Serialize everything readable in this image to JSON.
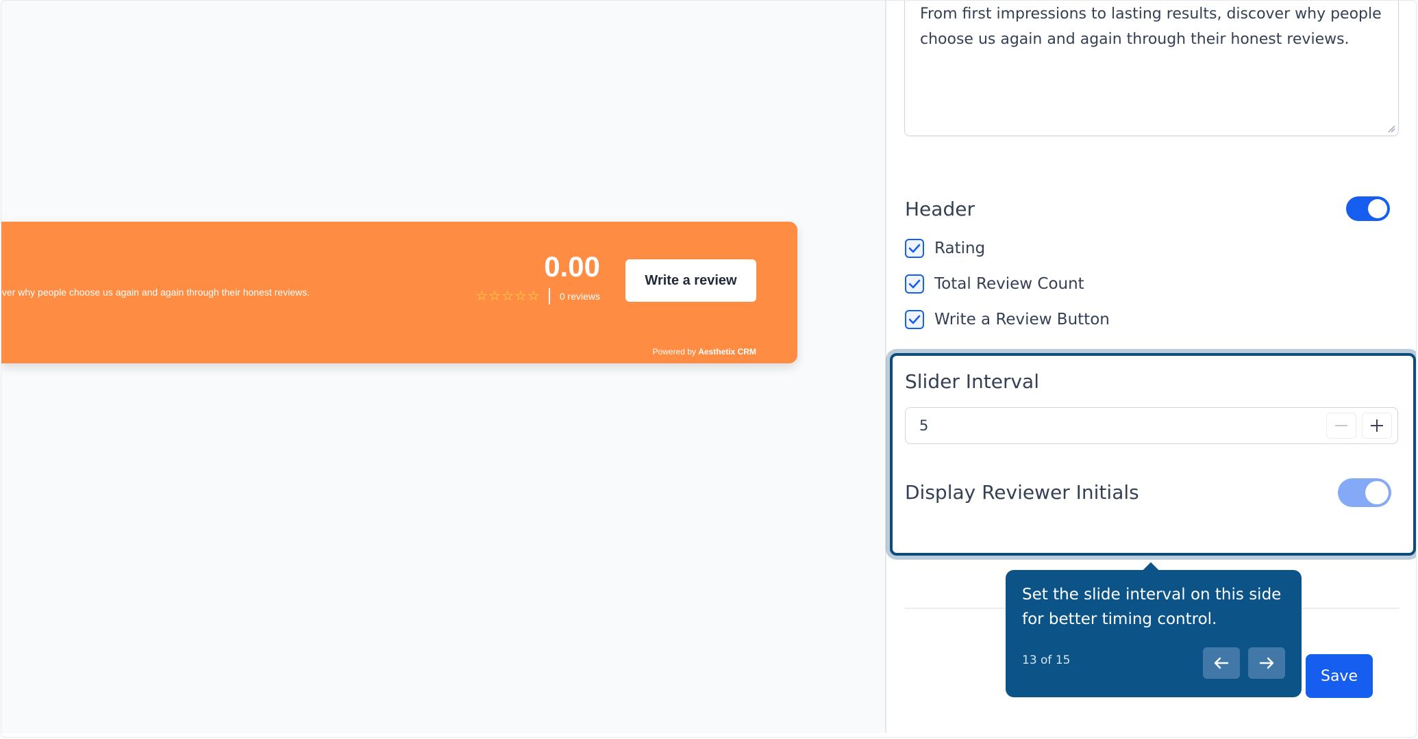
{
  "preview": {
    "description": "From first impressions to lasting results, discover why people choose us again and again through their honest reviews.",
    "rating": "0.00",
    "stars": "☆☆☆☆☆",
    "reviews_count": "0 reviews",
    "write_review_label": "Write a review",
    "powered_by": "Powered by",
    "powered_brand": "Aesthetix CRM"
  },
  "panel": {
    "description_text": "From first impressions to lasting results, discover why people choose us again and again through their honest reviews.",
    "header_label": "Header",
    "header_enabled": true,
    "checkboxes": [
      {
        "label": "Rating",
        "checked": true
      },
      {
        "label": "Total Review Count",
        "checked": true
      },
      {
        "label": "Write a Review Button",
        "checked": true
      }
    ],
    "slider_interval_label": "Slider Interval",
    "slider_interval_value": "5",
    "display_initials_label": "Display Reviewer Initials",
    "display_initials_enabled": true,
    "save_label": "Save"
  },
  "tooltip": {
    "text": "Set the slide interval on this side for better timing control.",
    "step": "13 of 15"
  },
  "colors": {
    "banner": "#fe8c42",
    "primary": "#155eef",
    "tooltip": "#0c5487",
    "star": "#ffe14a"
  },
  "icons": [
    "check-icon",
    "minus-icon",
    "plus-icon",
    "arrow-left-icon",
    "arrow-right-icon",
    "resize-grip-icon"
  ]
}
